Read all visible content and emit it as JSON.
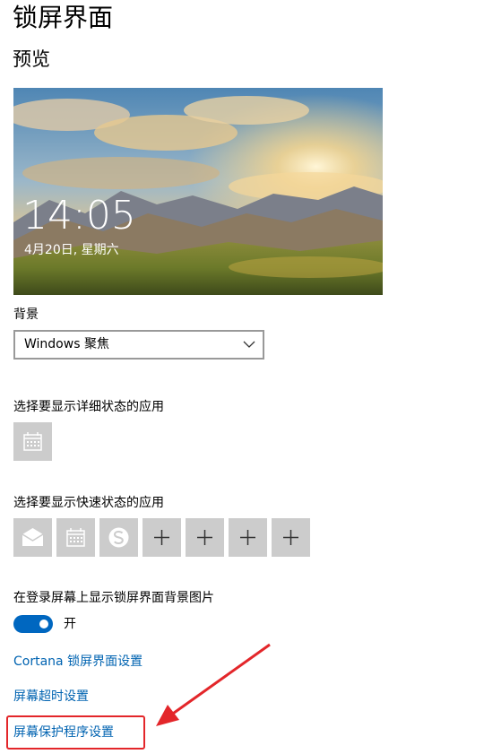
{
  "page": {
    "title": "锁屏界面",
    "preview_heading": "预览"
  },
  "preview": {
    "time": "14:05",
    "date": "4月20日, 星期六"
  },
  "background": {
    "label": "背景",
    "selected": "Windows 聚焦"
  },
  "detailed_status": {
    "label": "选择要显示详细状态的应用",
    "apps": [
      {
        "icon": "calendar-icon"
      }
    ]
  },
  "quick_status": {
    "label": "选择要显示快速状态的应用",
    "apps": [
      {
        "icon": "mail-icon"
      },
      {
        "icon": "calendar-icon"
      },
      {
        "icon": "skype-icon"
      },
      {
        "icon": "plus-icon"
      },
      {
        "icon": "plus-icon"
      },
      {
        "icon": "plus-icon"
      },
      {
        "icon": "plus-icon"
      }
    ]
  },
  "signin_background": {
    "label": "在登录屏幕上显示锁屏界面背景图片",
    "toggle_state": "开",
    "on": true
  },
  "links": {
    "cortana": "Cortana 锁屏界面设置",
    "timeout": "屏幕超时设置",
    "screensaver": "屏幕保护程序设置"
  },
  "colors": {
    "accent": "#0067c0",
    "link": "#0063b1",
    "tile": "#cccccc",
    "annotation": "#e3262a"
  }
}
